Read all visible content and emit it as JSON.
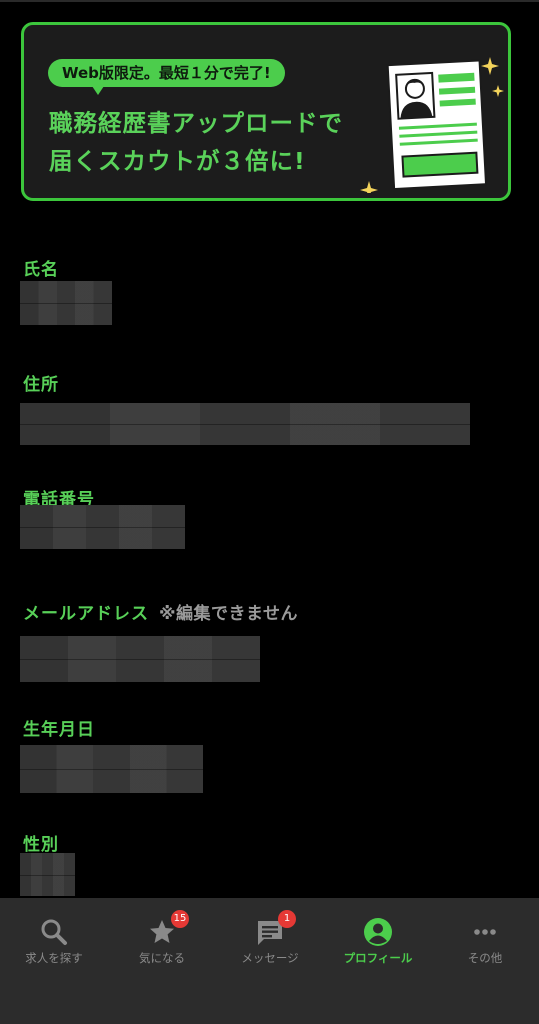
{
  "banner": {
    "pill_text": "Web版限定。最短１分で完了!",
    "headline_line1": "職務経歴書アップロードで",
    "headline_line2": "届くスカウトが３倍に!",
    "accent_color": "#4ccd4c"
  },
  "fields": [
    {
      "label": "氏名",
      "note": ""
    },
    {
      "label": "住所",
      "note": ""
    },
    {
      "label": "電話番号",
      "note": ""
    },
    {
      "label": "メールアドレス",
      "note": "※編集できません"
    },
    {
      "label": "生年月日",
      "note": ""
    },
    {
      "label": "性別",
      "note": ""
    }
  ],
  "nav": {
    "items": [
      {
        "label": "求人を探す",
        "icon": "search-icon",
        "badge": ""
      },
      {
        "label": "気になる",
        "icon": "star-icon",
        "badge": "15"
      },
      {
        "label": "メッセージ",
        "icon": "message-icon",
        "badge": "1"
      },
      {
        "label": "プロフィール",
        "icon": "profile-icon",
        "badge": ""
      },
      {
        "label": "その他",
        "icon": "more-icon",
        "badge": ""
      }
    ],
    "active_index": 3
  }
}
